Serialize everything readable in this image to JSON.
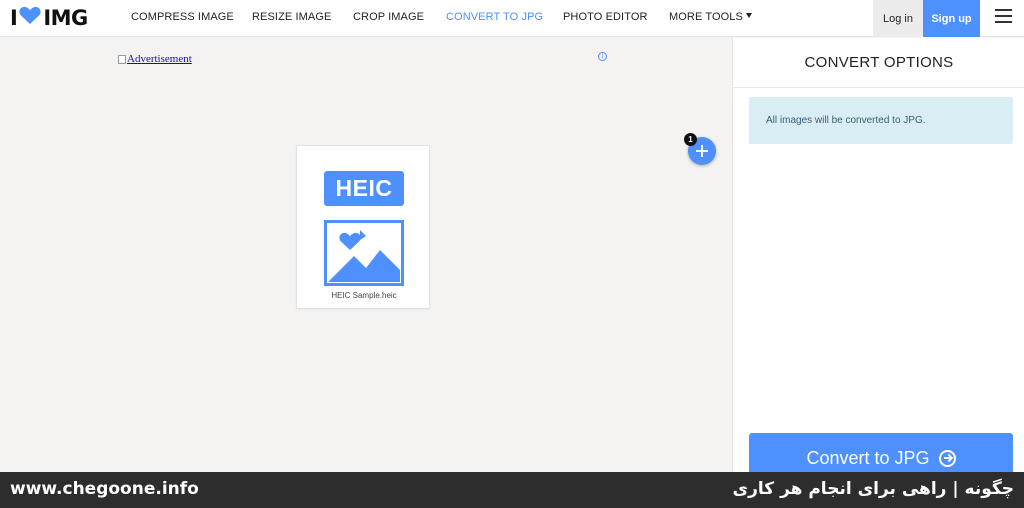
{
  "header": {
    "logo": {
      "left": "I",
      "right": "IMG"
    },
    "nav": [
      {
        "label": "COMPRESS IMAGE",
        "active": false
      },
      {
        "label": "RESIZE IMAGE",
        "active": false
      },
      {
        "label": "CROP IMAGE",
        "active": false
      },
      {
        "label": "CONVERT TO JPG",
        "active": true
      },
      {
        "label": "PHOTO EDITOR",
        "active": false
      },
      {
        "label": "MORE TOOLS",
        "active": false,
        "has_dropdown": true
      }
    ],
    "login_label": "Log in",
    "signup_label": "Sign up",
    "accent_color": "#4d90fe"
  },
  "workspace": {
    "ad_text": "Advertisement",
    "ad_info_symbol": "i",
    "file": {
      "badge": "HEIC",
      "name": "HEIC Sample.heic"
    },
    "file_count": "1"
  },
  "sidebar": {
    "title": "CONVERT OPTIONS",
    "info_text": "All images will be converted to JPG.",
    "convert_label": "Convert to JPG"
  },
  "banner": {
    "url": "www.chegoone.info",
    "tagline": "چگونه | راهی برای انجام هر کاری"
  }
}
